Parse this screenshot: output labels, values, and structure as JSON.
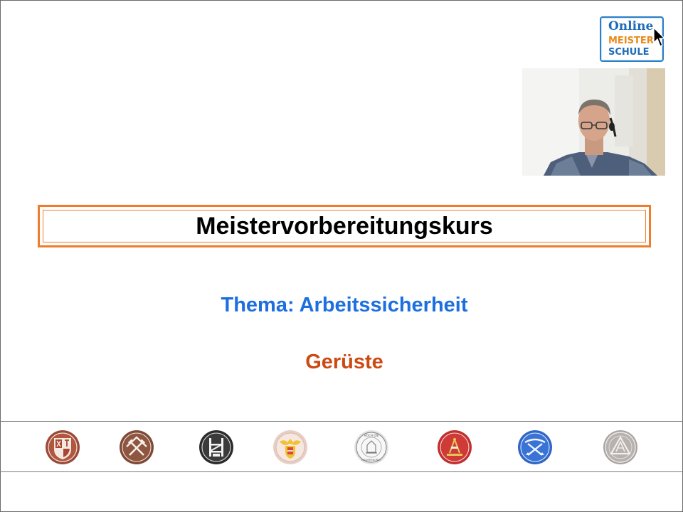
{
  "logo": {
    "line1": "Online",
    "line2": "MEISTER",
    "line3": "SCHULE"
  },
  "slide": {
    "title": "Meistervorbereitungskurs",
    "topic": "Thema: Arbeitssicherheit",
    "subtopic": "Gerüste"
  },
  "colors": {
    "title_border": "#ef7b2b",
    "topic": "#1d6fe0",
    "subtopic": "#cc4a12",
    "logo_blue": "#1f6db8",
    "logo_orange": "#e88a1a"
  },
  "guild_badges": [
    {
      "icon": "carpenter-guild-emblem-icon"
    },
    {
      "icon": "roofer-guild-emblem-icon"
    },
    {
      "icon": "scaffolder-guild-emblem-icon"
    },
    {
      "icon": "eagle-coat-of-arms-emblem-icon"
    },
    {
      "icon": "masons-guild-seal-icon",
      "text": "HOCH DIE MAURERKUNST"
    },
    {
      "icon": "plasterer-guild-emblem-icon"
    },
    {
      "icon": "tiler-guild-emblem-icon"
    },
    {
      "icon": "compass-triangle-emblem-icon"
    }
  ],
  "icons": {
    "cursor": "mouse-pointer-icon",
    "webcam": "presenter-webcam-video"
  }
}
